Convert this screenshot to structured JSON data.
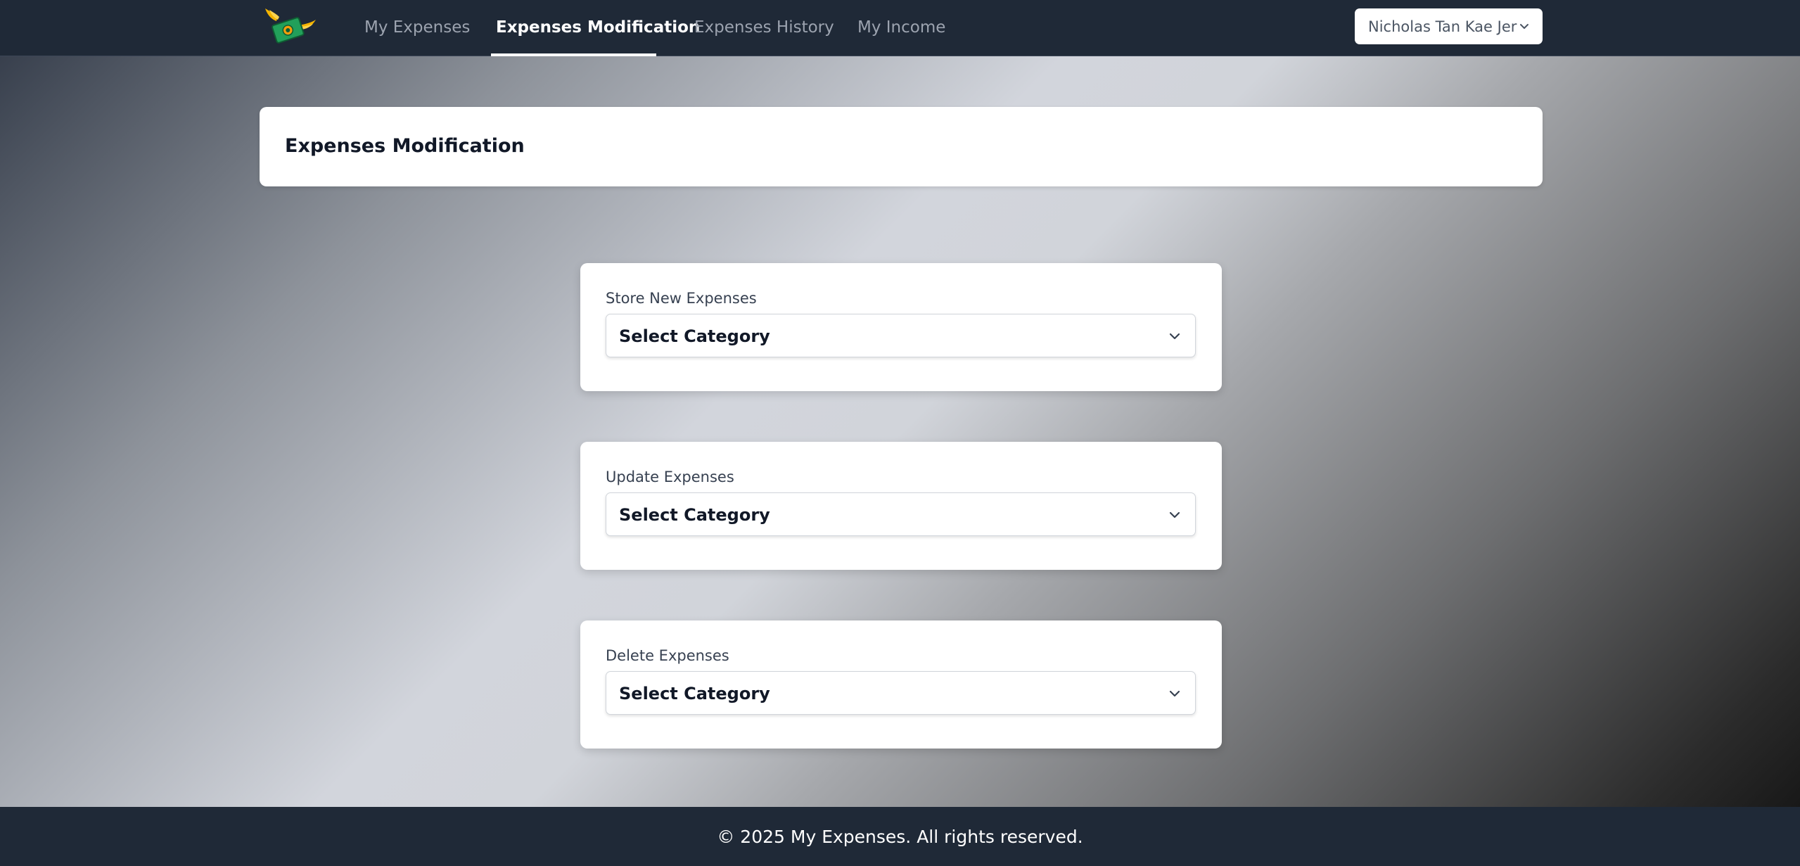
{
  "navbar": {
    "logo_icon": "flying-money-icon",
    "links": [
      {
        "label": "My Expenses",
        "active": false
      },
      {
        "label": "Expenses Modification",
        "active": true
      },
      {
        "label": "Expenses History",
        "active": false
      },
      {
        "label": "My Income",
        "active": false
      }
    ],
    "user": {
      "name": "Nicholas Tan Kae Jer",
      "icon": "chevron-down-icon"
    }
  },
  "header": {
    "title": "Expenses Modification"
  },
  "forms": [
    {
      "label": "Store New Expenses",
      "select_value": "Select Category"
    },
    {
      "label": "Update Expenses",
      "select_value": "Select Category"
    },
    {
      "label": "Delete Expenses",
      "select_value": "Select Category"
    }
  ],
  "footer": {
    "text": "© 2025 My Expenses. All rights reserved."
  },
  "colors": {
    "navbar_bg": "#1f2937",
    "card_bg": "#ffffff",
    "active_link": "#ffffff",
    "inactive_link": "#9ca3af"
  }
}
